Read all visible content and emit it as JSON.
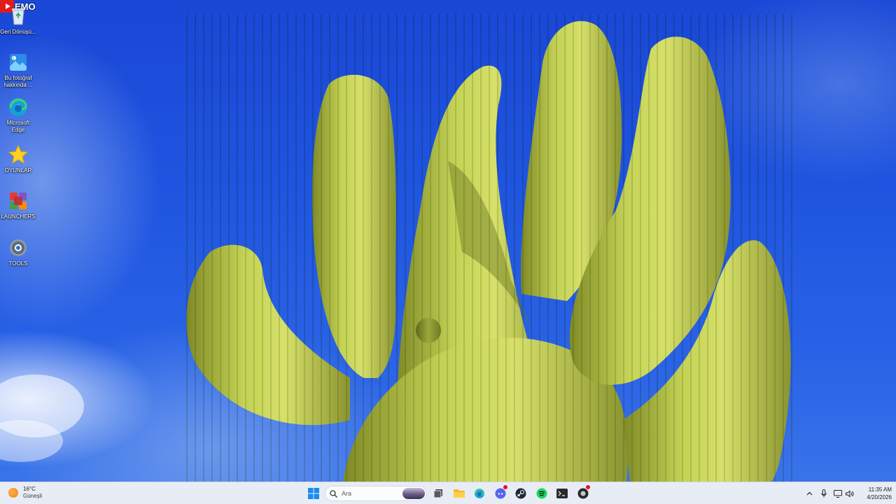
{
  "recording_badge": {
    "text": "EMO"
  },
  "desktop_icons": [
    {
      "label": "Geri Dönüşü...",
      "icon": "recycle-bin-icon"
    },
    {
      "label": "Bu fotoğraf hakkında ...",
      "icon": "photo-info-icon"
    },
    {
      "label": "Microsoft Edge",
      "icon": "edge-icon"
    },
    {
      "label": "OYUNLAR",
      "icon": "star-icon"
    },
    {
      "label": "LAUNCHERS",
      "icon": "launchers-icon"
    },
    {
      "label": "TOOLS",
      "icon": "gear-icon"
    }
  ],
  "taskbar": {
    "weather": {
      "temperature": "16°C",
      "condition": "Güneşli",
      "icon": "sun-icon"
    },
    "search": {
      "placeholder": "Ara"
    },
    "apps": [
      "start-icon",
      "search-icon",
      "task-view-icon",
      "file-explorer-icon",
      "edge-icon",
      "discord-icon",
      "steam-icon",
      "spotify-icon",
      "terminal-icon",
      "app-icon"
    ],
    "tray": [
      "chevron-up-icon",
      "microphone-icon",
      "display-icon",
      "volume-icon"
    ],
    "clock": {
      "time": "11:35 AM",
      "date": "4/20/2026"
    }
  },
  "colors": {
    "sky": "#1f55e0",
    "cactus": "#b8c94a",
    "taskbar": "#e8edf5"
  }
}
